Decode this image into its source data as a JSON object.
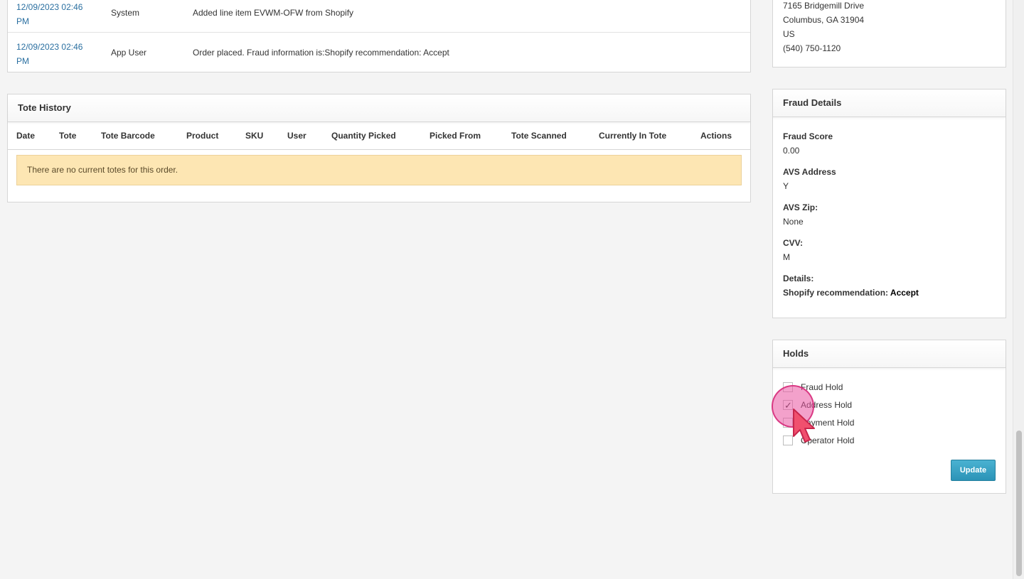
{
  "activity_log": {
    "rows": [
      {
        "date": "12/09/2023 02:46 PM",
        "user": "System",
        "message": "Added line item EVWM-OFW from Shopify"
      },
      {
        "date": "12/09/2023 02:46 PM",
        "user": "App User",
        "message": "Order placed. Fraud information is:Shopify recommendation: Accept"
      }
    ]
  },
  "tote_history": {
    "title": "Tote History",
    "columns": [
      "Date",
      "Tote",
      "Tote Barcode",
      "Product",
      "SKU",
      "User",
      "Quantity Picked",
      "Picked From",
      "Tote Scanned",
      "Currently In Tote",
      "Actions"
    ],
    "empty_message": "There are no current totes for this order."
  },
  "address": {
    "street": "7165 Bridgemill Drive",
    "city_line": "Columbus, GA 31904",
    "country": "US",
    "phone": "(540) 750-1120"
  },
  "fraud_details": {
    "title": "Fraud Details",
    "fraud_score_label": "Fraud Score",
    "fraud_score": "0.00",
    "avs_address_label": "AVS Address",
    "avs_address": "Y",
    "avs_zip_label": "AVS Zip:",
    "avs_zip": "None",
    "cvv_label": "CVV:",
    "cvv": "M",
    "details_label": "Details:",
    "details_prefix": "Shopify recommendation:",
    "details_value": "Accept"
  },
  "holds": {
    "title": "Holds",
    "items": [
      {
        "label": "Fraud Hold",
        "checked": false
      },
      {
        "label": "Address Hold",
        "checked": true
      },
      {
        "label": "Payment Hold",
        "checked": false
      },
      {
        "label": "Operator Hold",
        "checked": false
      }
    ],
    "update_label": "Update"
  },
  "colors": {
    "link": "#2a6fa0",
    "alert_bg": "#fde6b3",
    "button": "#2b93b7",
    "click_highlight": "#e954a0"
  }
}
